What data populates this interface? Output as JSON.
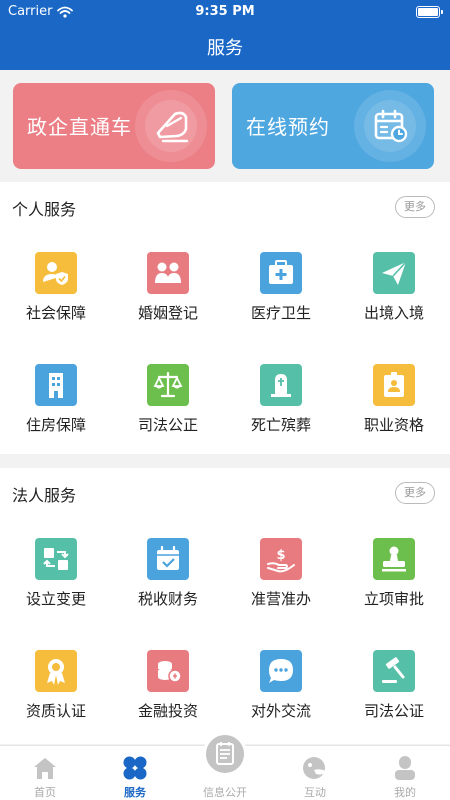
{
  "status_bar": {
    "carrier": "Carrier",
    "time": "9:35 PM"
  },
  "nav": {
    "title": "服务"
  },
  "banners": [
    {
      "label": "政企直通车",
      "icon": "train-icon",
      "color": "#ec7f86"
    },
    {
      "label": "在线预约",
      "icon": "calendar-icon",
      "color": "#4fa7e0"
    }
  ],
  "personal": {
    "title": "个人服务",
    "more": "更多",
    "items": [
      {
        "label": "社会保障",
        "icon": "social-security-icon",
        "color": "#f6bd3c"
      },
      {
        "label": "婚姻登记",
        "icon": "marriage-icon",
        "color": "#e87b80"
      },
      {
        "label": "医疗卫生",
        "icon": "medical-kit-icon",
        "color": "#4ba3de"
      },
      {
        "label": "出境入境",
        "icon": "paper-plane-icon",
        "color": "#55bfa8"
      },
      {
        "label": "住房保障",
        "icon": "building-icon",
        "color": "#4ba3de"
      },
      {
        "label": "司法公正",
        "icon": "scales-icon",
        "color": "#6cbf4c"
      },
      {
        "label": "死亡殡葬",
        "icon": "tombstone-icon",
        "color": "#55bfa8"
      },
      {
        "label": "职业资格",
        "icon": "id-badge-icon",
        "color": "#f6bd3c"
      }
    ]
  },
  "corporate": {
    "title": "法人服务",
    "more": "更多",
    "items": [
      {
        "label": "设立变更",
        "icon": "change-icon",
        "color": "#55bfa8"
      },
      {
        "label": "税收财务",
        "icon": "tax-calendar-icon",
        "color": "#4ba3de"
      },
      {
        "label": "准营准办",
        "icon": "money-hand-icon",
        "color": "#e87b80"
      },
      {
        "label": "立项审批",
        "icon": "stamp-icon",
        "color": "#6cbf4c"
      },
      {
        "label": "资质认证",
        "icon": "award-icon",
        "color": "#f6bd3c"
      },
      {
        "label": "金融投资",
        "icon": "coins-icon",
        "color": "#e87b80"
      },
      {
        "label": "对外交流",
        "icon": "chat-bubble-icon",
        "color": "#4ba3de"
      },
      {
        "label": "司法公证",
        "icon": "gavel-icon",
        "color": "#55bfa8"
      }
    ]
  },
  "tabs": [
    {
      "label": "首页",
      "icon": "home-icon",
      "active": false
    },
    {
      "label": "服务",
      "icon": "clover-icon",
      "active": true
    },
    {
      "label": "信息公开",
      "icon": "document-icon",
      "active": false
    },
    {
      "label": "互动",
      "icon": "interaction-icon",
      "active": false
    },
    {
      "label": "我的",
      "icon": "user-icon",
      "active": false
    }
  ],
  "colors": {
    "primary": "#1a67c6",
    "tab_inactive": "#aaaaaa"
  }
}
